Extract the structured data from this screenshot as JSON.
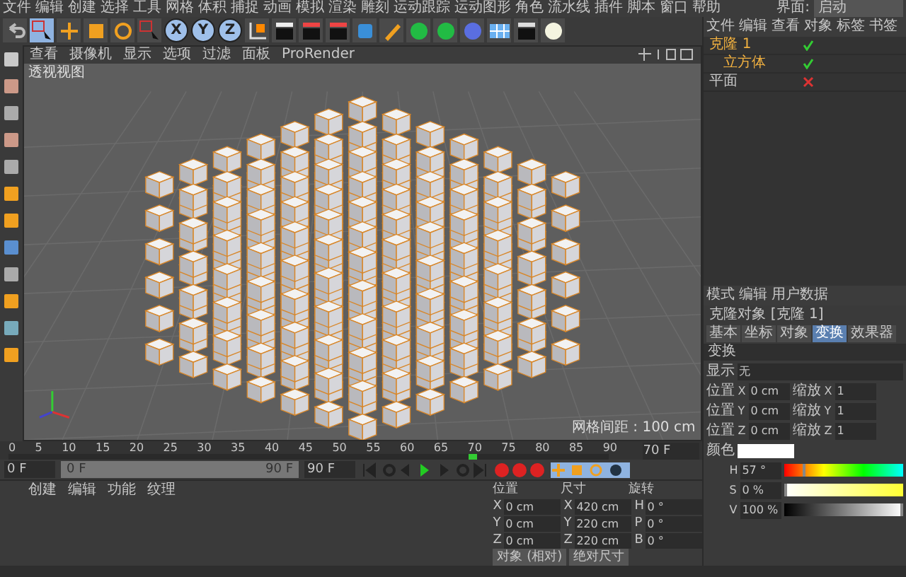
{
  "menu": [
    "文件",
    "编辑",
    "创建",
    "选择",
    "工具",
    "网格",
    "体积",
    "捕捉",
    "动画",
    "模拟",
    "渲染",
    "雕刻",
    "运动跟踪",
    "运动图形",
    "角色",
    "流水线",
    "插件",
    "脚本",
    "窗口",
    "帮助"
  ],
  "layout": {
    "label": "界面:",
    "value": "启动"
  },
  "axis_buttons": [
    {
      "label": "X",
      "on": true
    },
    {
      "label": "Y",
      "on": true
    },
    {
      "label": "Z",
      "on": true
    }
  ],
  "viewport": {
    "menu": [
      "查看",
      "摄像机",
      "显示",
      "选项",
      "过滤",
      "面板",
      "ProRender"
    ],
    "label": "透视视图",
    "grid_spacing": "网格间距 : 100 cm"
  },
  "objects": {
    "menu": [
      "文件",
      "编辑",
      "查看",
      "对象",
      "标签",
      "书签"
    ],
    "tree": [
      {
        "name": "克隆 1",
        "selected": true,
        "enabled": true,
        "children": [
          {
            "name": "立方体",
            "selected": true,
            "enabled": true
          }
        ]
      },
      {
        "name": "平面",
        "selected": false,
        "enabled": false
      }
    ]
  },
  "attributes": {
    "menu": [
      "模式",
      "编辑",
      "用户数据"
    ],
    "title": "克隆对象 [克隆 1]",
    "tabs": [
      {
        "label": "基本",
        "selected": false
      },
      {
        "label": "坐标",
        "selected": false
      },
      {
        "label": "对象",
        "selected": false
      },
      {
        "label": "变换",
        "selected": true
      },
      {
        "label": "效果器",
        "selected": false
      }
    ],
    "section": "变换",
    "display_label": "显示",
    "display_value": "无",
    "transform_rows": [
      {
        "pos_label": "位置",
        "pos_axis": "X",
        "pos_value": "0 cm",
        "scale_label": "缩放",
        "scale_axis": "X",
        "scale_value": "1"
      },
      {
        "pos_label": "位置",
        "pos_axis": "Y",
        "pos_value": "0 cm",
        "scale_label": "缩放",
        "scale_axis": "Y",
        "scale_value": "1"
      },
      {
        "pos_label": "位置",
        "pos_axis": "Z",
        "pos_value": "0 cm",
        "scale_label": "缩放",
        "scale_axis": "Z",
        "scale_value": "1"
      }
    ],
    "color_label": "颜色",
    "hsv": [
      {
        "kind": "hue",
        "label": "H",
        "value": "57 °",
        "level": 0.16
      },
      {
        "kind": "saturation",
        "label": "S",
        "value": "0 %",
        "level": 0
      },
      {
        "kind": "value",
        "label": "V",
        "value": "100 %",
        "level": 1
      }
    ]
  },
  "timeline": {
    "ticks": [
      "0",
      "5",
      "10",
      "15",
      "20",
      "25",
      "30",
      "35",
      "40",
      "45",
      "50",
      "55",
      "60",
      "65",
      "70",
      "75",
      "80",
      "85",
      "90"
    ],
    "level": 0.778,
    "frame": "70 F"
  },
  "transport": {
    "start": "0 F",
    "range_start": "0 F",
    "range_end": "90 F",
    "end": "90 F"
  },
  "materials": {
    "menu": [
      "创建",
      "编辑",
      "功能",
      "纹理"
    ]
  },
  "coordinates": {
    "headers": [
      "位置",
      "尺寸",
      "旋转"
    ],
    "rows": [
      {
        "a": "X",
        "av": "0 cm",
        "b": "X",
        "bv": "420 cm",
        "c": "H",
        "cv": "0 °"
      },
      {
        "a": "Y",
        "av": "0 cm",
        "b": "Y",
        "bv": "220 cm",
        "c": "P",
        "cv": "0 °"
      },
      {
        "a": "Z",
        "av": "0 cm",
        "b": "Z",
        "bv": "220 cm",
        "c": "B",
        "cv": "0 °"
      }
    ],
    "buttons": [
      "对象 (相对)",
      "绝对尺寸"
    ]
  }
}
